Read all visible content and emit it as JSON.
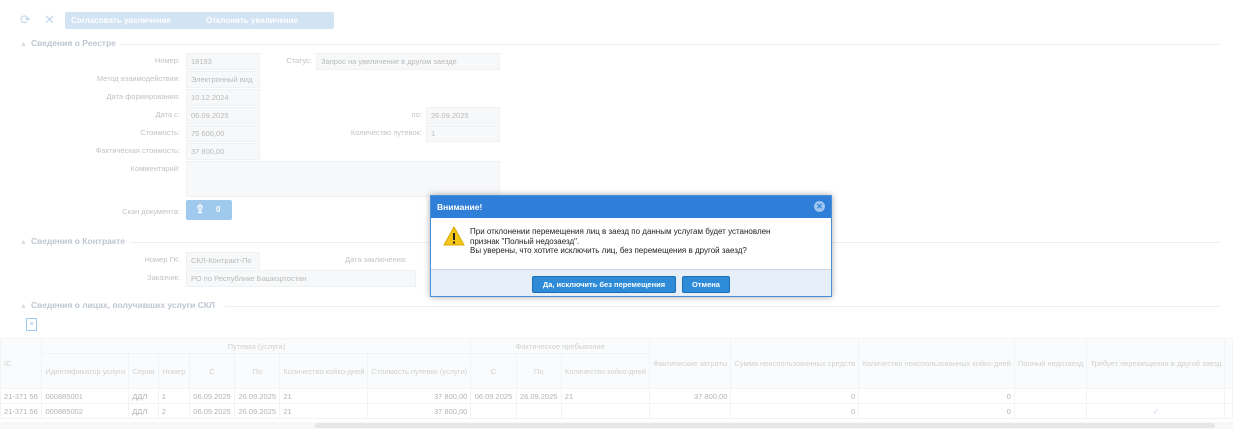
{
  "toolbar": {
    "refresh_icon": "refresh-icon",
    "close_icon": "close-icon",
    "approve_label": "Согласовать увеличение",
    "reject_label": "Отклонить увеличение"
  },
  "registry": {
    "legend": "Сведения о Реестре",
    "number_label": "Номер:",
    "number_value": "18193",
    "status_label": "Статус:",
    "status_value": "Запрос на увеличение в другом заезде",
    "method_label": "Метод взаимодействия:",
    "method_value": "Электронный вид",
    "formed_label": "Дата формирования:",
    "formed_value": "10.12.2024",
    "date_from_label": "Дата с:",
    "date_from_value": "06.09.2025",
    "date_to_label": "по:",
    "date_to_value": "26.09.2025",
    "cost_label": "Стоимость:",
    "cost_value": "75 600,00",
    "vouchers_label": "Количество путевок:",
    "vouchers_value": "1",
    "actual_cost_label": "Фактическая стоимость:",
    "actual_cost_value": "37 800,00",
    "comment_label": "Комментарий:",
    "scan_label": "Скан документа:",
    "upload_count": "0"
  },
  "contract": {
    "legend": "Сведения о Контракте",
    "gk_label": "Номер ГК:",
    "gk_value": "СКЛ-Контракт-По",
    "date_label": "Дата заключения:",
    "customer_label": "Заказчик:",
    "customer_value": "РО по Республике Башкортостан"
  },
  "persons": {
    "legend": "Сведения о лицах, получивших услуги СКЛ",
    "groups": {
      "voucher": "Путевка (услуга)",
      "actual_stay": "Фактическое пребывание"
    },
    "columns": {
      "ic": "IC",
      "service_id": "Идентификатор услуги",
      "series": "Серия",
      "number": "Номер",
      "from": "С",
      "to": "По",
      "bed_days": "Количество койко-дней",
      "voucher_cost": "Стоимость путевки (услуги)",
      "stay_from": "С",
      "stay_to": "По",
      "stay_bed_days": "Количество койко-дней",
      "actual_costs": "Фактические затраты",
      "unused_sum": "Сумма неиспользованных средств",
      "unused_days": "Количество неиспользованных койко-дней",
      "full_noshow": "Полный недозаезд",
      "requires_move": "Требует перемещения в другой заезд"
    },
    "rows": [
      {
        "ic": "21-371 56",
        "service_id": "000885001",
        "series": "ДДЛ",
        "number": "1",
        "from": "06.09.2025",
        "to": "26.09.2025",
        "bed_days": "21",
        "voucher_cost": "37 800,00",
        "stay_from": "06.09.2025",
        "stay_to": "26.09.2025",
        "stay_bed_days": "21",
        "actual_costs": "37 800,00",
        "unused_sum": "0",
        "unused_days": "0",
        "full_noshow": "",
        "requires_move": ""
      },
      {
        "ic": "21-371 56",
        "service_id": "000885002",
        "series": "ДДЛ",
        "number": "2",
        "from": "06.09.2025",
        "to": "26.09.2025",
        "bed_days": "21",
        "voucher_cost": "37 800,00",
        "stay_from": "",
        "stay_to": "",
        "stay_bed_days": "",
        "actual_costs": "",
        "unused_sum": "0",
        "unused_days": "0",
        "full_noshow": "",
        "requires_move": "✓"
      }
    ]
  },
  "dialog": {
    "title": "Внимание!",
    "line1": "При отклонении перемещения лиц в заезд по данным услугам будет установлен",
    "line2": "признак \"Полный недозаезд\".",
    "line3": "Вы уверены, что хотите исключить лиц, без перемещения в другой заезд?",
    "confirm_label": "Да, исключить без перемещения",
    "cancel_label": "Отмена",
    "warning_icon": "warning-icon",
    "close_icon": "close-icon"
  },
  "colors": {
    "accent": "#2e8bd8",
    "dialog_header": "#2f7ed8",
    "disabled_button": "#9cc3e6"
  }
}
